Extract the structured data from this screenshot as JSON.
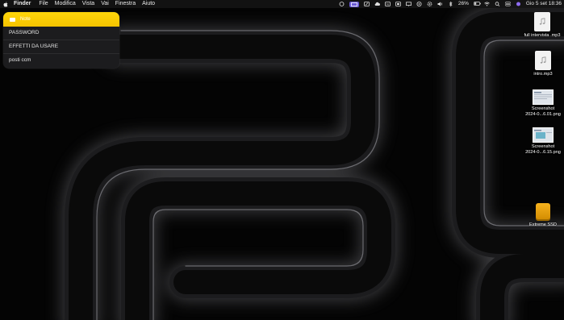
{
  "menubar": {
    "app_name": "Finder",
    "menus": [
      "File",
      "Modifica",
      "Vista",
      "Vai",
      "Finestra",
      "Aiuto"
    ],
    "battery": "26%",
    "datetime": "Gio 5 set  18:36",
    "active_color": "#6b5bd6"
  },
  "notes_widget": {
    "title": "Note",
    "accent": "#ffd60a",
    "items": [
      "PASSWORD",
      "EFFETTI DA USARE",
      "posti ccm"
    ]
  },
  "desktop": {
    "icons": [
      {
        "label": "full intervista .mp3",
        "type": "audio-file-icon"
      },
      {
        "label": "intro.mp3",
        "type": "audio-file-icon"
      },
      {
        "label_line1": "Screenshot",
        "label_line2": "2024-0...6.01.png",
        "type": "screenshot-file-icon"
      },
      {
        "label_line1": "Screenshot",
        "label_line2": "2024-0...6.15.png",
        "type": "screenshot-file-icon"
      },
      {
        "label": "Extreme SSD",
        "type": "external-drive-icon"
      }
    ]
  }
}
